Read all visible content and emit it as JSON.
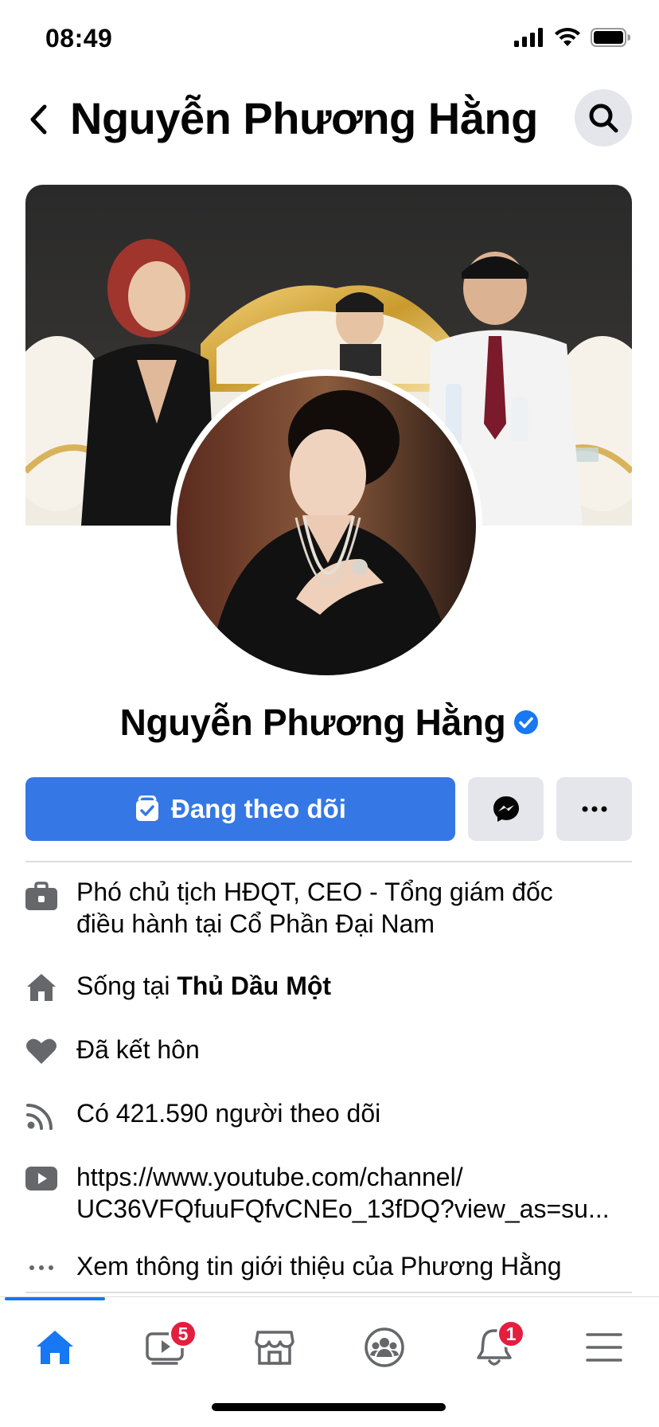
{
  "status_bar": {
    "time": "08:49"
  },
  "header": {
    "title": "Nguyễn Phương Hằng"
  },
  "profile": {
    "name": "Nguyễn Phương Hằng",
    "verified": true
  },
  "actions": {
    "follow_label": "Đang theo dõi"
  },
  "info": {
    "work_prefix": "Phó chủ tịch HĐQT, CEO - Tổng giám đốc",
    "work_line2": "điều hành tại Cổ Phần Đại Nam",
    "lives_prefix": "Sống tại ",
    "lives_city": "Thủ Dầu Một",
    "relationship": "Đã kết hôn",
    "followers": "Có 421.590 người theo dõi",
    "youtube_line1": "https://www.youtube.com/channel/",
    "youtube_line2": "UC36VFQfuuFQfvCNEo_13fDQ?view_as=su...",
    "see_about": "Xem thông tin giới thiệu của Phương Hằng"
  },
  "tabbar": {
    "video_badge": "5",
    "notifications_badge": "1"
  },
  "colors": {
    "accent": "#3578e5",
    "tab_active": "#1877f2",
    "badge": "#e41e3f",
    "button_gray": "#e4e6eb"
  },
  "icons": {
    "back": "chevron-left-icon",
    "search": "search-icon",
    "verified": "verified-badge-icon",
    "follow": "following-check-icon",
    "messenger": "messenger-icon",
    "more": "more-horizontal-icon",
    "work": "briefcase-icon",
    "home": "house-icon",
    "relationship": "heart-icon",
    "followers": "rss-icon",
    "youtube": "youtube-icon",
    "about": "ellipsis-icon"
  }
}
